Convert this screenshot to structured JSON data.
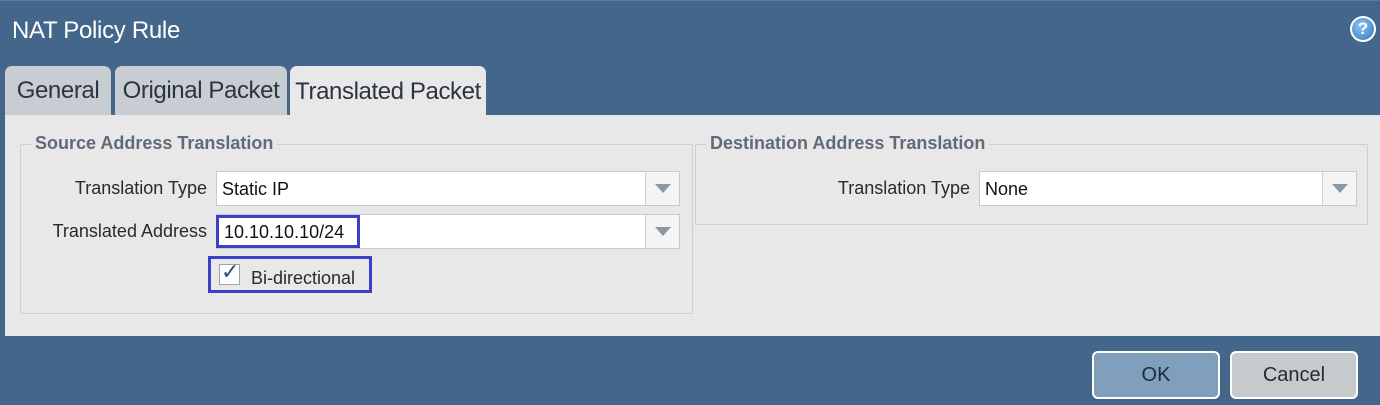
{
  "dialog": {
    "title": "NAT Policy Rule",
    "help_icon": "?"
  },
  "tabs": [
    {
      "label": "General",
      "active": false
    },
    {
      "label": "Original Packet",
      "active": false
    },
    {
      "label": "Translated Packet",
      "active": true
    }
  ],
  "source_translation": {
    "legend": "Source Address Translation",
    "translation_type_label": "Translation Type",
    "translation_type_value": "Static IP",
    "translated_address_label": "Translated Address",
    "translated_address_value": "10.10.10.10/24",
    "bidirectional_label": "Bi-directional",
    "bidirectional_checked": true
  },
  "destination_translation": {
    "legend": "Destination Address Translation",
    "translation_type_label": "Translation Type",
    "translation_type_value": "None"
  },
  "buttons": {
    "ok": "OK",
    "cancel": "Cancel"
  },
  "colors": {
    "frame": "#44668a",
    "panel": "#e8e8e8",
    "highlight": "#3c3fc9",
    "ok_button": "#7f9fbd",
    "cancel_button": "#c7cacd"
  },
  "icons": {
    "help": "help-icon",
    "dropdown": "chevron-down-icon",
    "checkbox": "checkmark-icon"
  }
}
